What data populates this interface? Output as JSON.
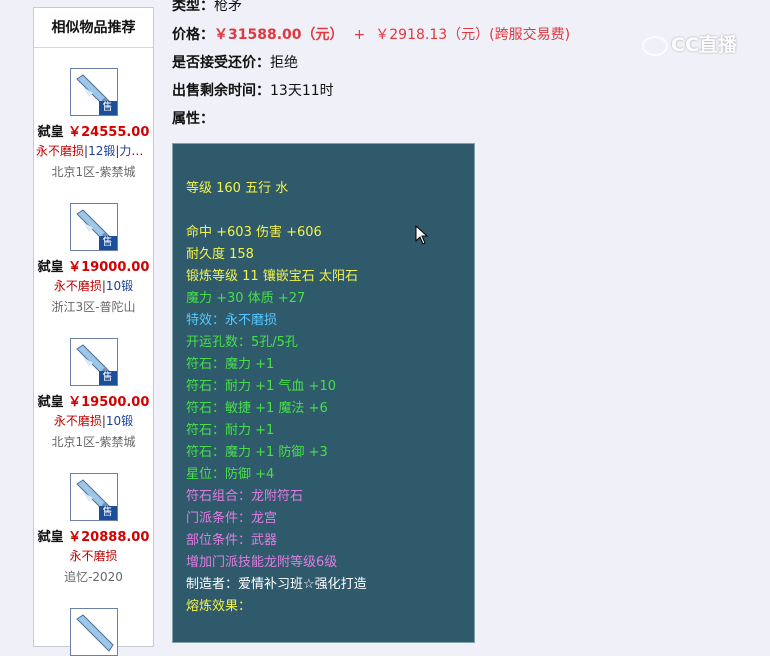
{
  "sidebar": {
    "title": "相似物品推荐",
    "items": [
      {
        "seller": "弑皇",
        "price": "￥24555.00",
        "attr_red": "永不磨损",
        "sep1": "|",
        "attr2": "12锻",
        "sep2": "|",
        "attr3": "力耐…",
        "server": "北京1区-紫禁城"
      },
      {
        "seller": "弑皇",
        "price": "￥19000.00",
        "attr_red": "永不磨损",
        "sep1": "|",
        "attr2": "10锻",
        "sep2": "",
        "attr3": "",
        "server": "浙江3区-普陀山"
      },
      {
        "seller": "弑皇",
        "price": "￥19500.00",
        "attr_red": "永不磨损",
        "sep1": "|",
        "attr2": "10锻",
        "sep2": "",
        "attr3": "",
        "server": "北京1区-紫禁城"
      },
      {
        "seller": "弑皇",
        "price": "￥20888.00",
        "attr_red": "永不磨损",
        "sep1": "",
        "attr2": "",
        "sep2": "",
        "attr3": "",
        "server": "追忆-2020"
      }
    ],
    "sell_tag": "售"
  },
  "info": {
    "type_label": "类型：",
    "type_value": "枪矛",
    "price_label": "价格：",
    "price_value": "￥31588.00（元）",
    "plus": "+",
    "fee_value": "￥2918.13（元）(跨服交易费)",
    "bargain_label": "是否接受还价：",
    "bargain_value": "拒绝",
    "time_label": "出售剩余时间：",
    "time_value": "13天11时",
    "attr_label": "属性："
  },
  "attributes": [
    {
      "text": "等级 160 五行 水",
      "color": "yellow"
    },
    {
      "text": "命中 +603 伤害 +606",
      "color": "yellow"
    },
    {
      "text": "耐久度 158",
      "color": "yellow"
    },
    {
      "text": "锻炼等级 11 镶嵌宝石 太阳石",
      "color": "yellow"
    },
    {
      "text": "魔力 +30 体质 +27",
      "color": "green"
    },
    {
      "text": "特效：永不磨损",
      "color": "cyan"
    },
    {
      "text": "开运孔数：5孔/5孔",
      "color": "green"
    },
    {
      "text": "符石：魔力 +1",
      "color": "green"
    },
    {
      "text": "符石：耐力 +1 气血 +10",
      "color": "green"
    },
    {
      "text": "符石：敏捷 +1 魔法 +6",
      "color": "green"
    },
    {
      "text": "符石：耐力 +1",
      "color": "green"
    },
    {
      "text": "符石：魔力 +1 防御 +3",
      "color": "green"
    },
    {
      "text": "星位：防御 +4",
      "color": "green"
    },
    {
      "text": "符石组合：龙附符石",
      "color": "pink"
    },
    {
      "text": "门派条件：龙宫",
      "color": "pink"
    },
    {
      "text": "部位条件：武器",
      "color": "pink"
    },
    {
      "text": "增加门派技能龙附等级6级",
      "color": "pink"
    },
    {
      "text": "制造者：爱情补习班☆强化打造",
      "color": "white"
    },
    {
      "text": "熔炼效果：",
      "color": "yellow"
    }
  ],
  "watermark": {
    "text": "CC直播"
  },
  "colors": {
    "price_red": "#e0383e",
    "box_bg": "#2f5a6c",
    "yellow": "#f2f24a",
    "green": "#46e046",
    "cyan": "#56c8ff",
    "pink": "#e07de0"
  }
}
